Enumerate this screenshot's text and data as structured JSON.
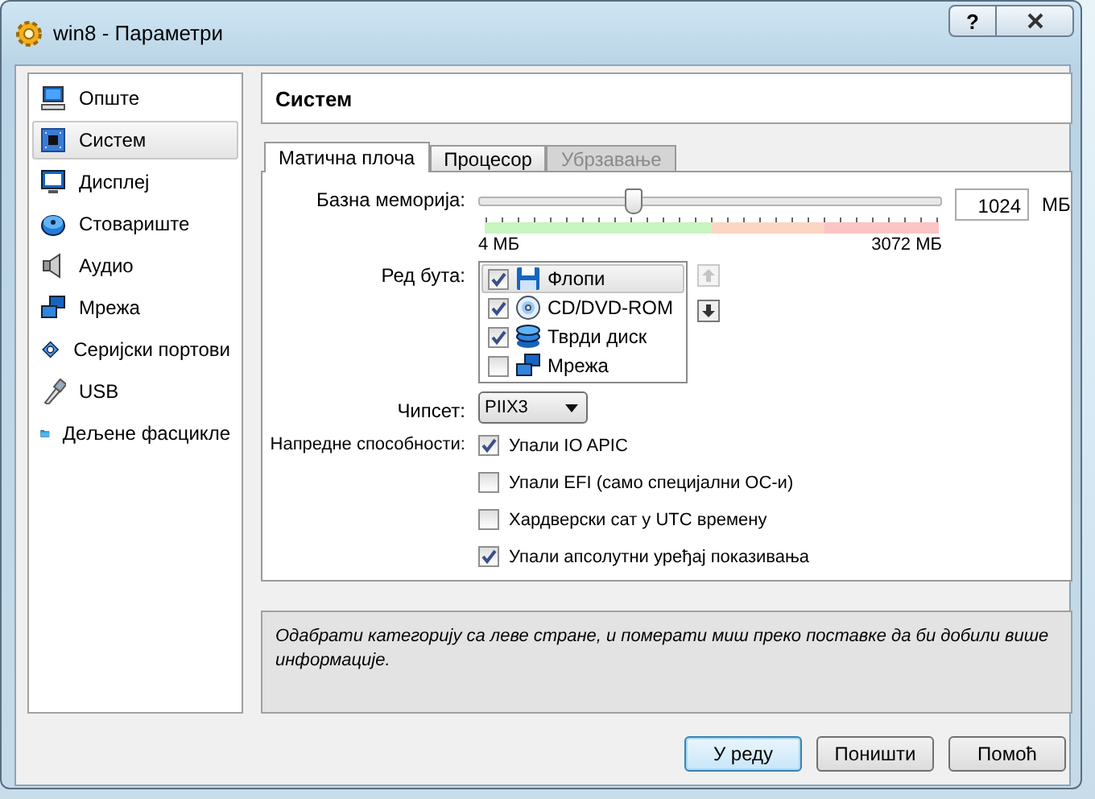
{
  "window": {
    "title": "win8 - Параметри",
    "help": "?"
  },
  "sidebar": {
    "items": [
      {
        "label": "Опште",
        "selected": false
      },
      {
        "label": "Систем",
        "selected": true
      },
      {
        "label": "Дисплеј",
        "selected": false
      },
      {
        "label": "Стовариште",
        "selected": false
      },
      {
        "label": "Аудио",
        "selected": false
      },
      {
        "label": "Мрежа",
        "selected": false
      },
      {
        "label": "Серијски портови",
        "selected": false
      },
      {
        "label": "USB",
        "selected": false
      },
      {
        "label": "Дељене фасцикле",
        "selected": false
      }
    ]
  },
  "section_title": "Систем",
  "tabs": [
    {
      "label": "Матична плоча",
      "selected": true,
      "disabled": false
    },
    {
      "label": "Процесор",
      "selected": false,
      "disabled": false
    },
    {
      "label": "Убрзавање",
      "selected": false,
      "disabled": true
    }
  ],
  "memory": {
    "label": "Базна меморија:",
    "level": 0.333,
    "min_label": "4 МБ",
    "max_label": "3072 МБ",
    "value": "1024",
    "unit": "МБ"
  },
  "boot_order": {
    "label": "Ред бута:",
    "items": [
      {
        "label": "Флопи",
        "checked": true,
        "selected": true
      },
      {
        "label": "CD/DVD-ROM",
        "checked": true,
        "selected": false
      },
      {
        "label": "Тврди диск",
        "checked": true,
        "selected": false
      },
      {
        "label": "Мрежа",
        "checked": false,
        "selected": false
      }
    ],
    "move_up": {
      "disabled": true
    },
    "move_down": {
      "disabled": false
    }
  },
  "chipset": {
    "label": "Чипсет:",
    "value": "PIIX3"
  },
  "features": {
    "label": "Напредне способности:",
    "options": [
      {
        "label": "Упали IO APIC",
        "checked": true
      },
      {
        "label": "Упали EFI (само специјални ОС-и)",
        "checked": false
      },
      {
        "label": "Хардверски сат у UTC времену",
        "checked": false
      },
      {
        "label": "Упали апсолутни уређај показивања",
        "checked": true
      }
    ]
  },
  "info": "Одабрати категорију са леве стране, и померати миш преко поставке да би добили више информације.",
  "buttons": [
    {
      "label": "У реду",
      "default": true
    },
    {
      "label": "Поништи",
      "default": false
    },
    {
      "label": "Помоћ",
      "default": false
    }
  ]
}
